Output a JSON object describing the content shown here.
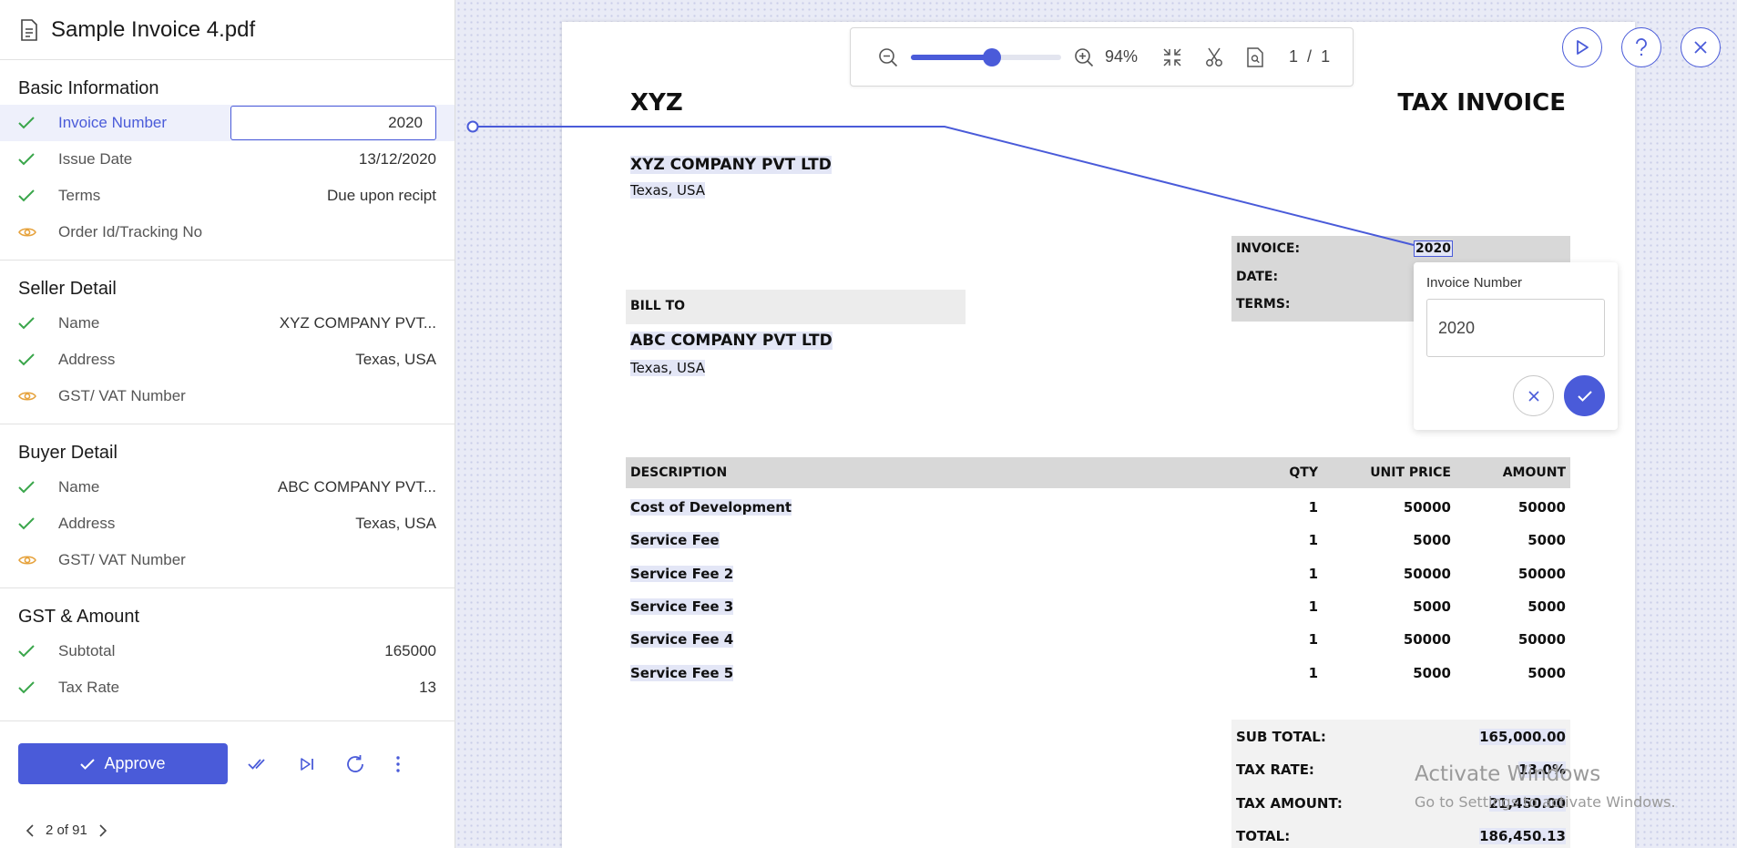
{
  "file": {
    "title": "Sample Invoice 4.pdf"
  },
  "sections": {
    "basic": {
      "title": "Basic Information",
      "invoice_number": {
        "label": "Invoice Number",
        "value": "2020"
      },
      "issue_date": {
        "label": "Issue Date",
        "value": "13/12/2020"
      },
      "terms": {
        "label": "Terms",
        "value": "Due upon recipt"
      },
      "order_id": {
        "label": "Order Id/Tracking No"
      }
    },
    "seller": {
      "title": "Seller Detail",
      "name": {
        "label": "Name",
        "value": "XYZ COMPANY PVT..."
      },
      "address": {
        "label": "Address",
        "value": "Texas, USA"
      },
      "gst": {
        "label": "GST/ VAT Number"
      }
    },
    "buyer": {
      "title": "Buyer Detail",
      "name": {
        "label": "Name",
        "value": "ABC COMPANY PVT..."
      },
      "address": {
        "label": "Address",
        "value": "Texas, USA"
      },
      "gst": {
        "label": "GST/ VAT Number"
      }
    },
    "gst": {
      "title": "GST & Amount",
      "subtotal": {
        "label": "Subtotal",
        "value": "165000"
      },
      "tax_rate": {
        "label": "Tax Rate",
        "value": "13"
      }
    }
  },
  "actions": {
    "approve_label": "Approve"
  },
  "pager": {
    "text": "2 of 91"
  },
  "toolbar": {
    "zoom": "94%",
    "zoom_fraction": 0.54,
    "page_current": "1",
    "page_sep": "/",
    "page_total": "1"
  },
  "popup": {
    "label": "Invoice Number",
    "value": "2020"
  },
  "doc": {
    "company": "XYZ",
    "doc_title": "TAX INVOICE",
    "seller_name": "XYZ COMPANY PVT LTD",
    "seller_address": "Texas, USA",
    "meta": {
      "invoice_label": "INVOICE:",
      "invoice_value": "2020",
      "date_label": "DATE:",
      "terms_label": "TERMS:"
    },
    "bill_to": "BILL TO",
    "buyer_name": "ABC COMPANY PVT LTD",
    "buyer_address": "Texas, USA",
    "headers": {
      "description": "DESCRIPTION",
      "qty": "QTY",
      "unit_price": "UNIT PRICE",
      "amount": "AMOUNT"
    },
    "items": [
      {
        "description": "Cost of Development",
        "qty": "1",
        "unit_price": "50000",
        "amount": "50000"
      },
      {
        "description": "Service Fee",
        "qty": "1",
        "unit_price": "5000",
        "amount": "5000"
      },
      {
        "description": "Service Fee 2",
        "qty": "1",
        "unit_price": "50000",
        "amount": "50000"
      },
      {
        "description": "Service Fee 3",
        "qty": "1",
        "unit_price": "5000",
        "amount": "5000"
      },
      {
        "description": "Service Fee 4",
        "qty": "1",
        "unit_price": "50000",
        "amount": "50000"
      },
      {
        "description": "Service Fee 5",
        "qty": "1",
        "unit_price": "5000",
        "amount": "5000"
      }
    ],
    "totals": [
      {
        "label": "SUB TOTAL:",
        "value": "165,000.00"
      },
      {
        "label": "TAX RATE:",
        "value": "13.0%"
      },
      {
        "label": "TAX AMOUNT:",
        "value": "21,450.00"
      },
      {
        "label": "TOTAL:",
        "value": "186,450.13"
      }
    ]
  },
  "watermark": {
    "line1": "Activate Windows",
    "line2": "Go to Settings to activate Windows."
  },
  "colors": {
    "accent": "#4a5bd9",
    "check": "#3aa64b",
    "eye": "#e6a23c"
  },
  "icons": {
    "document": "document-icon",
    "check": "check-icon",
    "eye": "eye-icon"
  }
}
